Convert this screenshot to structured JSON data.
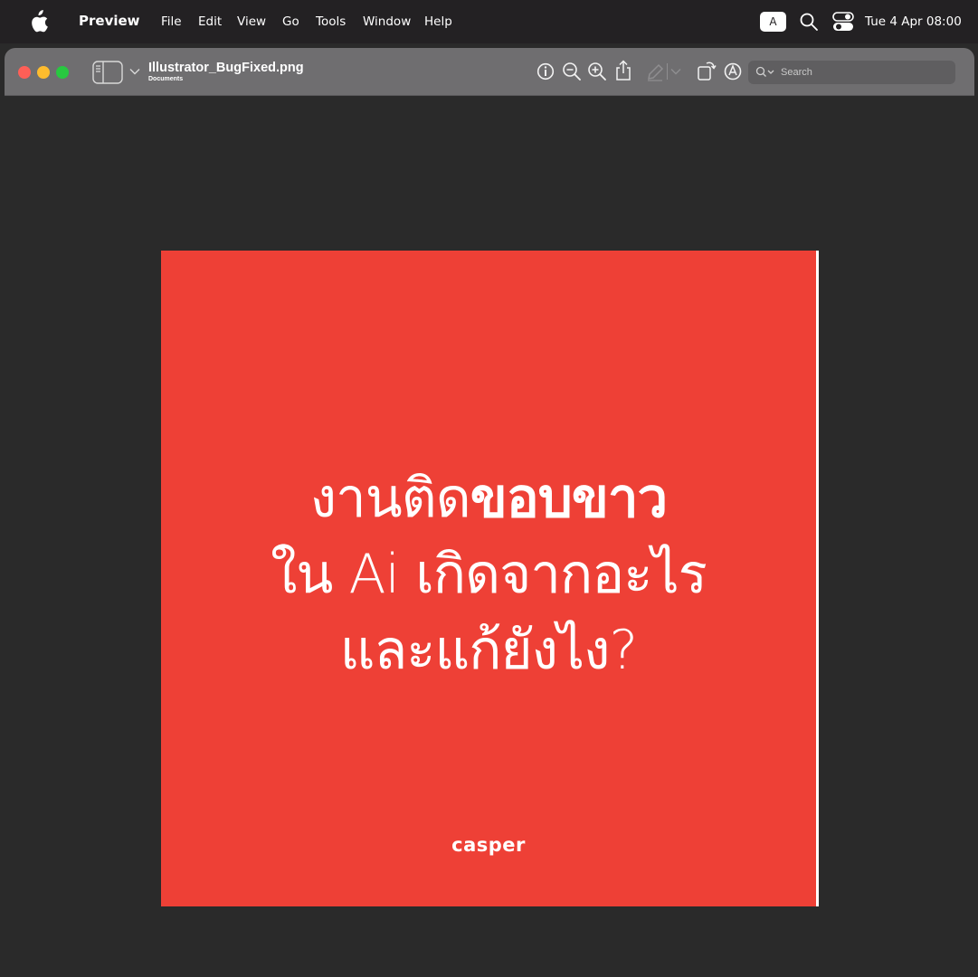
{
  "menubar": {
    "app_name": "Preview",
    "menus": [
      "File",
      "Edit",
      "View",
      "Go",
      "Tools",
      "Window",
      "Help"
    ],
    "input_source": "A",
    "clock": "Tue 4 Apr  08:00"
  },
  "window": {
    "title": "Illustrator_BugFixed.png",
    "subtitle": "Documents",
    "search_placeholder": "Search"
  },
  "document": {
    "headline_line1_light": "งานติด",
    "headline_line1_bold": "ขอบขาว",
    "headline_line2": "ใน Ai เกิดจากอะไร",
    "headline_line3": "และแก้ยังไง?",
    "brand": "casper",
    "background_color": "#ee4036"
  },
  "colors": {
    "menubar": "#232123",
    "toolbar": "#6f6e70",
    "canvas": "#2a2a2a",
    "close": "#fe5f57",
    "minimize": "#febc2e",
    "maximize": "#28c840"
  }
}
